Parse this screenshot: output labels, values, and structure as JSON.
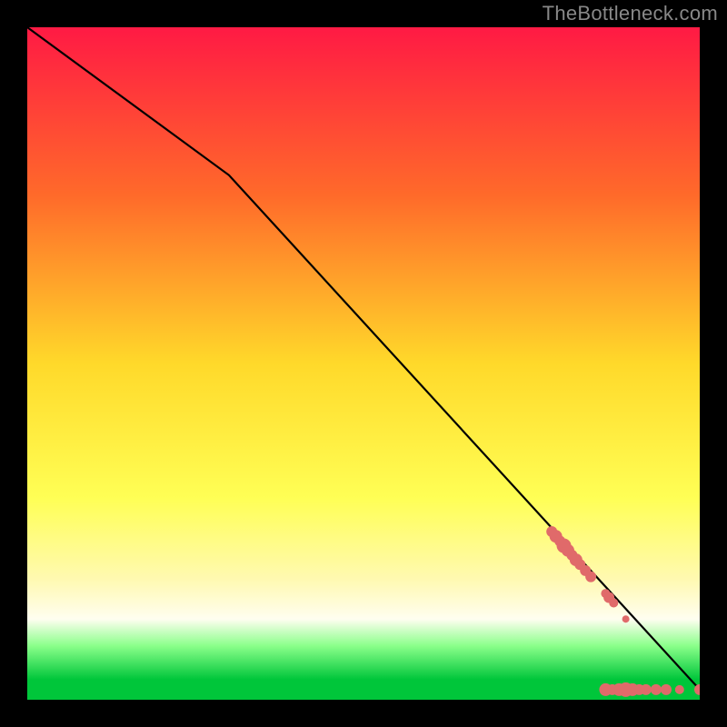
{
  "watermark": "TheBottleneck.com",
  "chart_data": {
    "type": "line",
    "title": "",
    "xlabel": "",
    "ylabel": "",
    "xlim": [
      0,
      100
    ],
    "ylim": [
      0,
      100
    ],
    "grid": false,
    "background_gradient": {
      "stops": [
        {
          "y": 0,
          "color": "#ff1a44"
        },
        {
          "y": 25,
          "color": "#ff6a2a"
        },
        {
          "y": 50,
          "color": "#ffd92a"
        },
        {
          "y": 70,
          "color": "#ffff55"
        },
        {
          "y": 82,
          "color": "#fff9b0"
        },
        {
          "y": 88,
          "color": "#fffef0"
        },
        {
          "y": 92,
          "color": "#8aff8a"
        },
        {
          "y": 97,
          "color": "#00c63a"
        },
        {
          "y": 100,
          "color": "#00c63a"
        }
      ]
    },
    "series": [
      {
        "name": "curve",
        "x": [
          0,
          30,
          100
        ],
        "y": [
          100,
          78,
          1.5
        ],
        "stroke": "#000000"
      }
    ],
    "scatter": {
      "name": "points",
      "color": "#e06a6a",
      "points": [
        {
          "x": 78.0,
          "y": 25.0,
          "r": 6
        },
        {
          "x": 78.6,
          "y": 24.3,
          "r": 7
        },
        {
          "x": 79.2,
          "y": 23.6,
          "r": 6
        },
        {
          "x": 79.8,
          "y": 22.9,
          "r": 8
        },
        {
          "x": 80.4,
          "y": 22.2,
          "r": 7
        },
        {
          "x": 81.0,
          "y": 21.5,
          "r": 6
        },
        {
          "x": 81.6,
          "y": 20.8,
          "r": 7
        },
        {
          "x": 82.2,
          "y": 20.1,
          "r": 6
        },
        {
          "x": 83.0,
          "y": 19.2,
          "r": 6
        },
        {
          "x": 83.8,
          "y": 18.3,
          "r": 6
        },
        {
          "x": 86.0,
          "y": 15.8,
          "r": 5
        },
        {
          "x": 86.5,
          "y": 15.2,
          "r": 6
        },
        {
          "x": 87.2,
          "y": 14.4,
          "r": 5
        },
        {
          "x": 89.0,
          "y": 12.0,
          "r": 4
        },
        {
          "x": 86.0,
          "y": 1.5,
          "r": 7
        },
        {
          "x": 87.0,
          "y": 1.5,
          "r": 6
        },
        {
          "x": 88.0,
          "y": 1.5,
          "r": 7
        },
        {
          "x": 89.0,
          "y": 1.5,
          "r": 8
        },
        {
          "x": 90.0,
          "y": 1.5,
          "r": 7
        },
        {
          "x": 91.0,
          "y": 1.5,
          "r": 6
        },
        {
          "x": 92.0,
          "y": 1.5,
          "r": 6
        },
        {
          "x": 93.5,
          "y": 1.5,
          "r": 6
        },
        {
          "x": 95.0,
          "y": 1.5,
          "r": 6
        },
        {
          "x": 97.0,
          "y": 1.5,
          "r": 5
        },
        {
          "x": 100.0,
          "y": 1.5,
          "r": 6
        }
      ]
    }
  }
}
